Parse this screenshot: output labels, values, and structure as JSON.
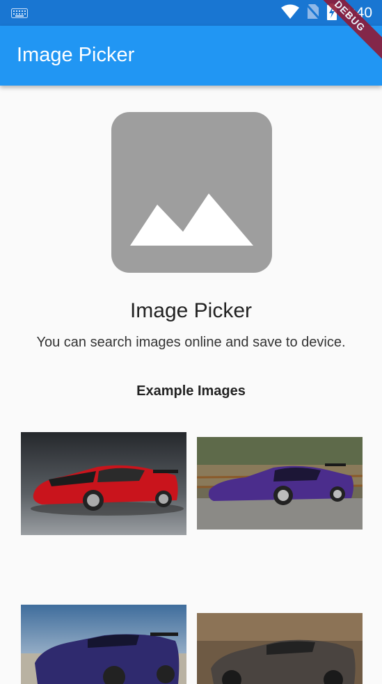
{
  "status_bar": {
    "time": "4:40"
  },
  "app_bar": {
    "title": "Image Picker",
    "debug_label": "DEBUG"
  },
  "main": {
    "title": "Image Picker",
    "subtitle": "You can search images online and save to device.",
    "examples_heading": "Example Images"
  },
  "examples": [
    {
      "name": "red-sports-car-image"
    },
    {
      "name": "purple-sports-car-image"
    },
    {
      "name": "blue-skyline-car-image"
    },
    {
      "name": "bronze-sports-car-image"
    }
  ]
}
